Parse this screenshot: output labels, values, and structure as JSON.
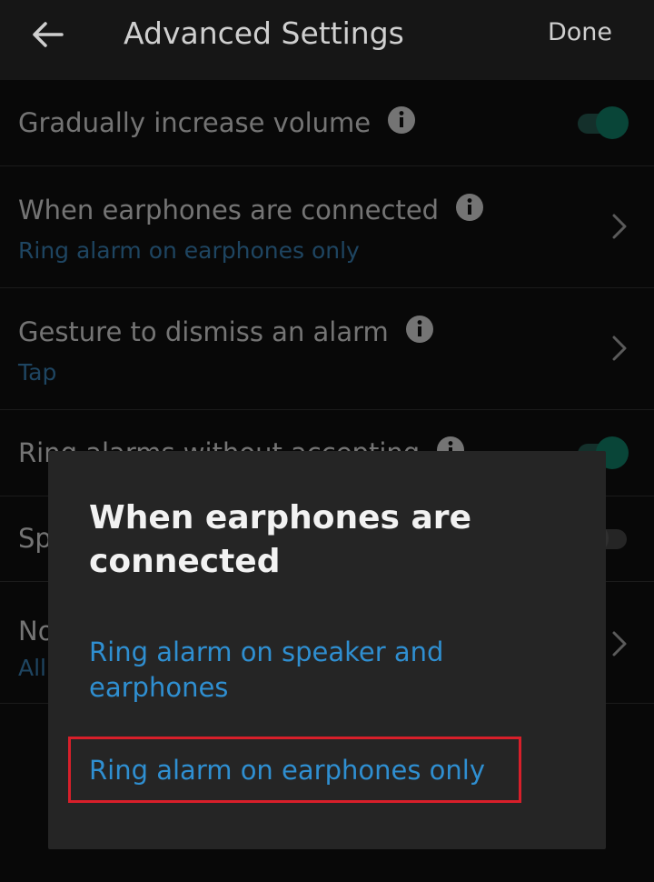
{
  "header": {
    "title": "Advanced Settings",
    "done_label": "Done"
  },
  "settings": [
    {
      "title": "Gradually increase volume",
      "control": "toggle",
      "state": "on"
    },
    {
      "title": "When earphones are connected",
      "subtitle": "Ring alarm on earphones only",
      "control": "chevron"
    },
    {
      "title": "Gesture to dismiss an alarm",
      "subtitle": "Tap",
      "control": "chevron"
    },
    {
      "title": "Ring alarms without accepting",
      "control": "toggle",
      "state": "on"
    },
    {
      "title": "Sp",
      "control": "toggle",
      "state": "off"
    },
    {
      "title": "No",
      "subtitle": "All",
      "control": "chevron"
    }
  ],
  "dialog": {
    "title": "When earphones are connected",
    "options": [
      "Ring alarm on speaker and earphones",
      "Ring alarm on earphones only"
    ],
    "highlighted_option": "Ring alarm on earphones only"
  },
  "colors": {
    "accent_blue": "#2f8fd1",
    "toggle_on": "#0e6a57",
    "highlight_border": "#d81f2a"
  }
}
